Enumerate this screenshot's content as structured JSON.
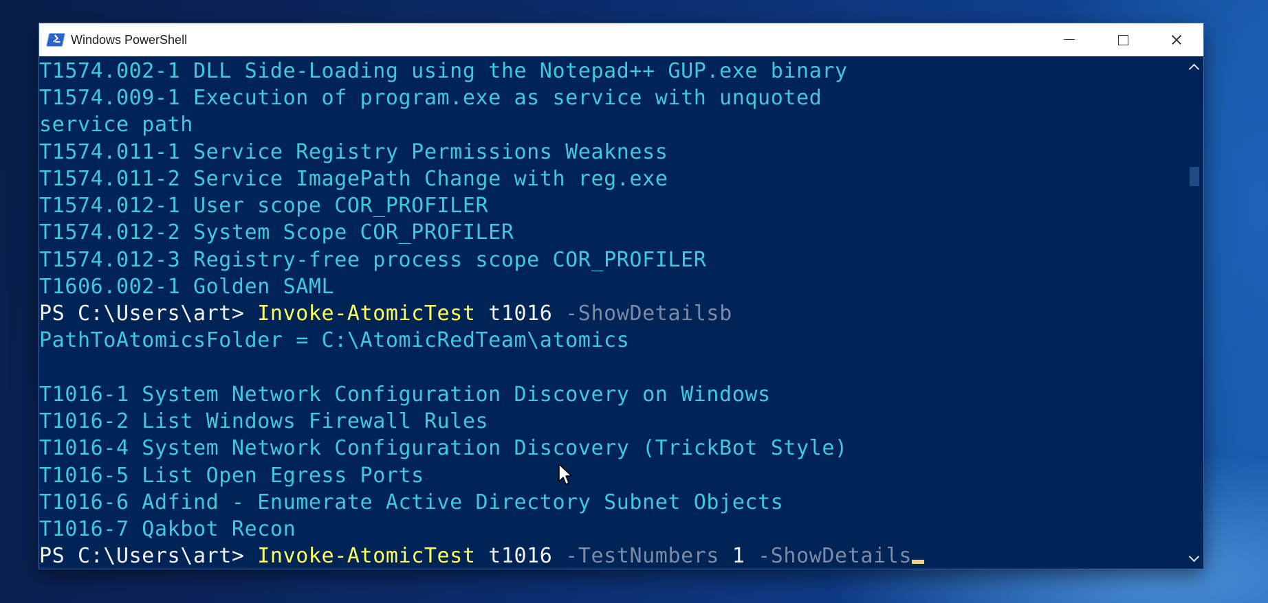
{
  "window": {
    "title": "Windows PowerShell"
  },
  "console": {
    "lines": [
      {
        "type": "output",
        "text": "T1574.002-1 DLL Side-Loading using the Notepad++ GUP.exe binary"
      },
      {
        "type": "output",
        "text": "T1574.009-1 Execution of program.exe as service with unquoted"
      },
      {
        "type": "output",
        "text": "service path"
      },
      {
        "type": "output",
        "text": "T1574.011-1 Service Registry Permissions Weakness"
      },
      {
        "type": "output",
        "text": "T1574.011-2 Service ImagePath Change with reg.exe"
      },
      {
        "type": "output",
        "text": "T1574.012-1 User scope COR_PROFILER"
      },
      {
        "type": "output",
        "text": "T1574.012-2 System Scope COR_PROFILER"
      },
      {
        "type": "output",
        "text": "T1574.012-3 Registry-free process scope COR_PROFILER"
      },
      {
        "type": "output",
        "text": "T1606.002-1 Golden SAML"
      },
      {
        "type": "prompt",
        "prompt": "PS C:\\Users\\art> ",
        "cmd": "Invoke-AtomicTest",
        "arg": " t1016",
        "param": " -ShowDetailsb"
      },
      {
        "type": "output",
        "text": "PathToAtomicsFolder = C:\\AtomicRedTeam\\atomics"
      },
      {
        "type": "output",
        "text": ""
      },
      {
        "type": "output",
        "text": "T1016-1 System Network Configuration Discovery on Windows"
      },
      {
        "type": "output",
        "text": "T1016-2 List Windows Firewall Rules"
      },
      {
        "type": "output",
        "text": "T1016-4 System Network Configuration Discovery (TrickBot Style)"
      },
      {
        "type": "output",
        "text": "T1016-5 List Open Egress Ports"
      },
      {
        "type": "output",
        "text": "T1016-6 Adfind - Enumerate Active Directory Subnet Objects"
      },
      {
        "type": "output",
        "text": "T1016-7 Qakbot Recon"
      },
      {
        "type": "prompt",
        "prompt": "PS C:\\Users\\art> ",
        "cmd": "Invoke-AtomicTest",
        "arg": " t1016",
        "param": " -TestNumbers",
        "arg2": " 1",
        "param2": " -ShowDetails"
      }
    ]
  },
  "colors": {
    "console_background": "#012456",
    "output_text": "#40c8dc",
    "prompt_text": "#f2f2f2",
    "command_text": "#ffff5a",
    "parameter_text": "#7d8aa6",
    "cursor": "#f5d28c"
  },
  "icons": {
    "app": "powershell-icon",
    "minimize": "minimize-icon",
    "maximize": "maximize-icon",
    "close": "close-icon"
  }
}
